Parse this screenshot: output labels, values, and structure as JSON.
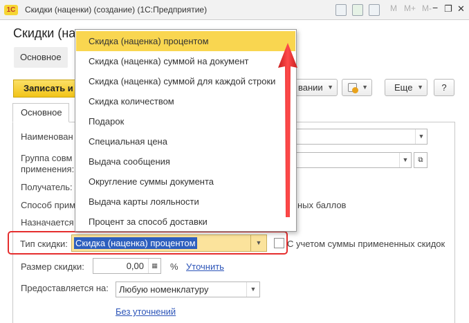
{
  "window": {
    "logo": "1С",
    "title": "Скидки (наценки) (создание)  (1С:Предприятие)",
    "toolbar_icons": [
      "document-icon",
      "table-icon",
      "calendar-icon"
    ],
    "memory_buttons": [
      "M",
      "M+",
      "M-"
    ],
    "controls": [
      "minimize-icon",
      "restore-icon",
      "close-icon"
    ],
    "minimize_glyph": "−",
    "restore_glyph": "❐",
    "close_glyph": "✕"
  },
  "form": {
    "heading": "Скидки (на",
    "nav_tab": "Основное",
    "save_button": "Записать и",
    "create_basis_button": "вании",
    "more_button": "Еще",
    "help_button": "?",
    "tab_main": "Основное"
  },
  "fields": {
    "name_label": "Наименован",
    "group_label_line1": "Группа совм",
    "group_label_line2": "применения:",
    "recipient_label": "Получатель:",
    "method_label": "Способ прим",
    "bonus_tail": "ных баллов",
    "assigned_label": "Назначается",
    "type_label": "Тип скидки:",
    "type_value": "Скидка (наценка) процентом",
    "with_applied_label": "С учетом суммы примененных скидок",
    "with_applied_checked": false,
    "size_label": "Размер скидки:",
    "size_value": "0,00",
    "percent_sign": "%",
    "clarify_link": "Уточнить",
    "provided_label": "Предоставляется на:",
    "provided_value": "Любую номенклатуру",
    "no_clarify_link": "Без уточнений"
  },
  "dropdown": {
    "items": [
      "Скидка (наценка) процентом",
      "Скидка (наценка) суммой на документ",
      "Скидка (наценка) суммой для каждой строки",
      "Скидка количеством",
      "Подарок",
      "Специальная цена",
      "Выдача сообщения",
      "Округление суммы документа",
      "Выдача карты лояльности",
      "Процент за способ доставки"
    ],
    "selected_index": 0
  },
  "annotation": {
    "highlight_color": "#e52d2d",
    "arrow_color": "#e52d2d"
  }
}
